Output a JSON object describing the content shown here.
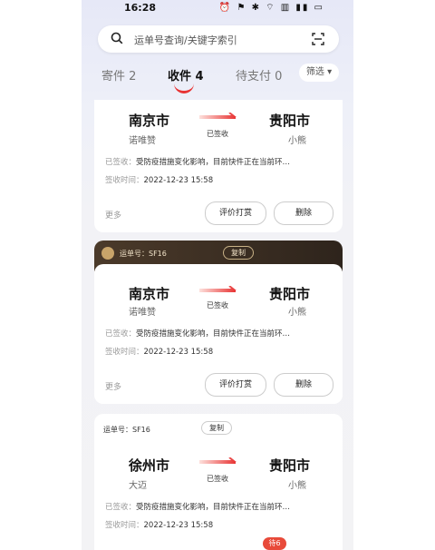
{
  "status": {
    "time": "16:28",
    "icons": "⏰ ⚑ ✱ ⌔ ▥ ▮▮ ▭"
  },
  "search": {
    "placeholder": "运单号查询/关键字索引"
  },
  "tabs": [
    {
      "label": "寄件 2"
    },
    {
      "label": "收件 4"
    },
    {
      "label": "待支付 0"
    }
  ],
  "filter": {
    "label": "筛选 ▾"
  },
  "cards": [
    {
      "waybill": "",
      "copy": "",
      "from_city": "南京市",
      "from_name": "诺唯赞",
      "state": "已签收",
      "to_city": "贵阳市",
      "to_name": "小熊",
      "sign_label": "已签收：",
      "sign_text": "受防疫措施变化影响，目前快件正在当前环…",
      "time_label": "签收时间：",
      "time_value": "2022-12-23 15:58",
      "more": "更多",
      "btn_rate": "评价打赏",
      "btn_delete": "删除"
    },
    {
      "waybill": "运单号：SF16",
      "copy": "复制",
      "from_city": "南京市",
      "from_name": "诺唯赞",
      "state": "已签收",
      "to_city": "贵阳市",
      "to_name": "小熊",
      "sign_label": "已签收：",
      "sign_text": "受防疫措施变化影响，目前快件正在当前环…",
      "time_label": "签收时间：",
      "time_value": "2022-12-23 15:58",
      "more": "更多",
      "btn_rate": "评价打赏",
      "btn_delete": "删除"
    },
    {
      "waybill": "运单号：SF16",
      "copy": "复制",
      "from_city": "徐州市",
      "from_name": "大迈",
      "state": "已签收",
      "to_city": "贵阳市",
      "to_name": "小熊",
      "sign_label": "已签收：",
      "sign_text": "受防疫措施变化影响，目前快件正在当前环…",
      "time_label": "签收时间：",
      "time_value": "2022-12-23 15:58"
    }
  ],
  "bottom_badge": "待6",
  "colors": {
    "accent": "#e83434",
    "header_brown": "#3b2e22"
  }
}
